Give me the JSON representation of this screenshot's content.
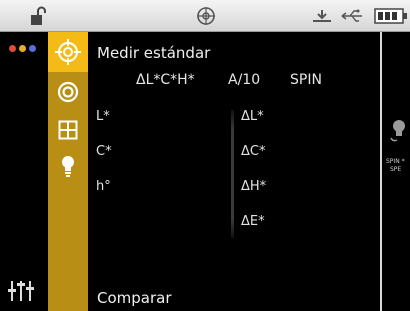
{
  "status_bar": {
    "icons": [
      "unlock-icon",
      "globe-icon",
      "usb-icon",
      "usb-cable-icon",
      "battery-icon"
    ]
  },
  "rail": {
    "dot_colors": [
      "#e14a3c",
      "#e8b021",
      "#5a6fd6"
    ],
    "bottom_icon": "sliders-icon"
  },
  "sidebar": {
    "tabs": [
      {
        "icon": "target-icon",
        "active": true
      },
      {
        "icon": "ring-icon",
        "active": false
      },
      {
        "icon": "grid-icon",
        "active": false
      },
      {
        "icon": "lightbulb-icon",
        "active": false
      }
    ],
    "accent": "#f4bb16",
    "bar_color": "#b88f14"
  },
  "main": {
    "title": "Medir estándar",
    "config": {
      "color_space": "ΔL*C*H*",
      "illuminant": "A/10",
      "mode": "SPIN"
    },
    "left_labels": [
      "L*",
      "C*",
      "h°"
    ],
    "right_labels": [
      "ΔL*",
      "ΔC*",
      "ΔH*",
      "ΔE*"
    ],
    "compare": "Comparar"
  },
  "right_panel": {
    "line1": "SPIN *",
    "line2": "SPE"
  }
}
